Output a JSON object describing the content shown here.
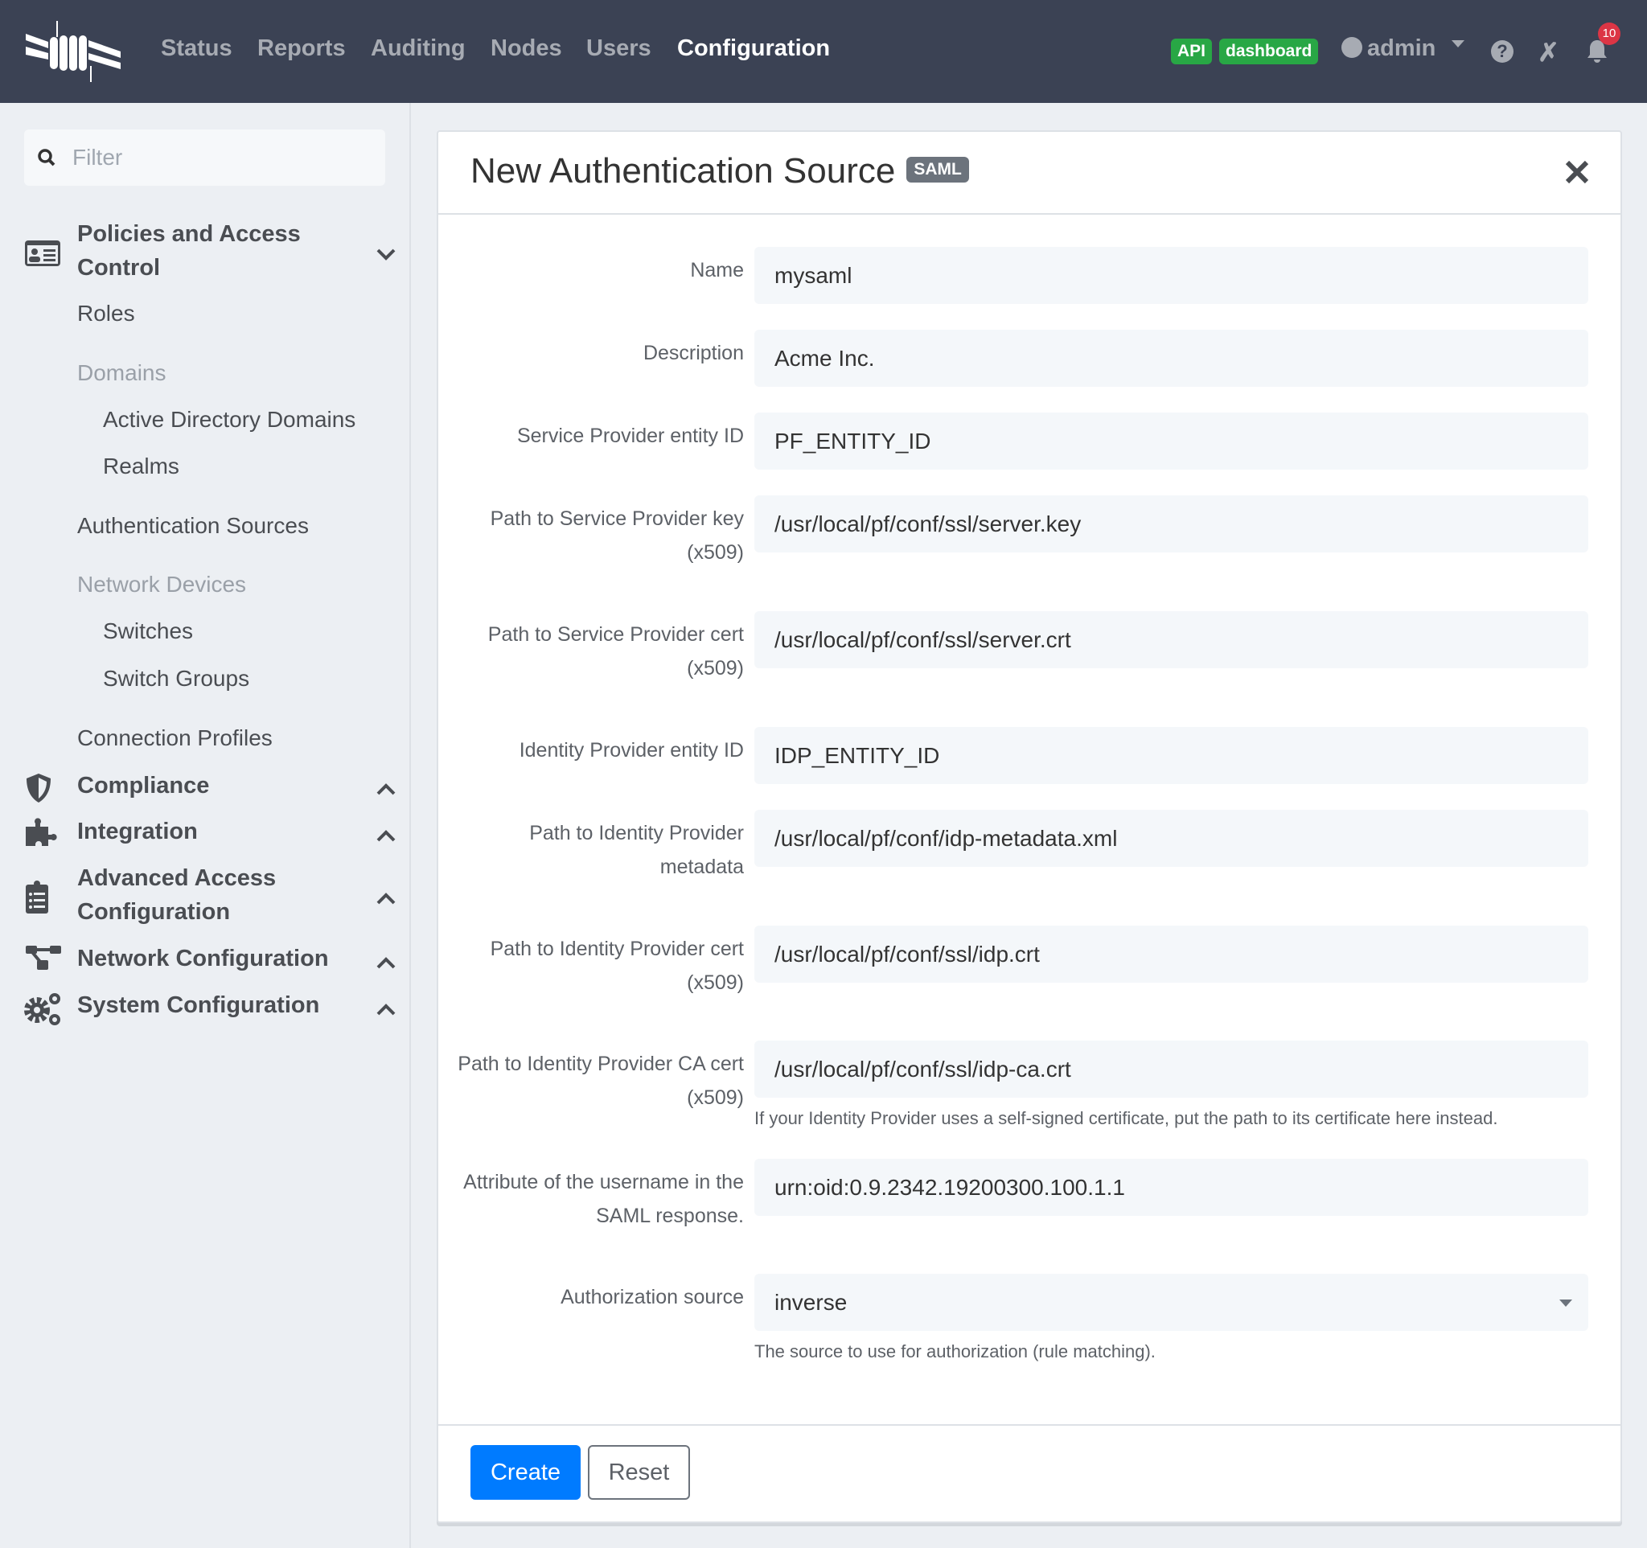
{
  "topbar": {
    "nav": [
      "Status",
      "Reports",
      "Auditing",
      "Nodes",
      "Users",
      "Configuration"
    ],
    "active": "Configuration",
    "api_badge": "API",
    "dashboard_badge": "dashboard",
    "user": "admin",
    "notifications": "10"
  },
  "sidebar": {
    "filter_placeholder": "Filter",
    "sections": {
      "policies": "Policies and Access Control",
      "compliance": "Compliance",
      "integration": "Integration",
      "advanced": "Advanced Access Configuration",
      "network": "Network Configuration",
      "system": "System Configuration"
    },
    "items": {
      "roles": "Roles",
      "domains": "Domains",
      "ad_domains": "Active Directory Domains",
      "realms": "Realms",
      "auth_sources": "Authentication Sources",
      "network_devices": "Network Devices",
      "switches": "Switches",
      "switch_groups": "Switch Groups",
      "connection_profiles": "Connection Profiles"
    }
  },
  "form": {
    "title": "New Authentication Source",
    "type_badge": "SAML",
    "fields": [
      {
        "label": "Name",
        "value": "mysaml"
      },
      {
        "label": "Description",
        "value": "Acme Inc."
      },
      {
        "label": "Service Provider entity ID",
        "value": "PF_ENTITY_ID"
      },
      {
        "label": "Path to Service Provider key (x509)",
        "value": "/usr/local/pf/conf/ssl/server.key"
      },
      {
        "label": "Path to Service Provider cert (x509)",
        "value": "/usr/local/pf/conf/ssl/server.crt"
      },
      {
        "label": "Identity Provider entity ID",
        "value": "IDP_ENTITY_ID"
      },
      {
        "label": "Path to Identity Provider metadata",
        "value": "/usr/local/pf/conf/idp-metadata.xml"
      },
      {
        "label": "Path to Identity Provider cert (x509)",
        "value": "/usr/local/pf/conf/ssl/idp.crt"
      },
      {
        "label": "Path to Identity Provider CA cert (x509)",
        "value": "/usr/local/pf/conf/ssl/idp-ca.crt",
        "help": "If your Identity Provider uses a self-signed certificate, put the path to its certificate here instead."
      },
      {
        "label": "Attribute of the username in the SAML response.",
        "value": "urn:oid:0.9.2342.19200300.100.1.1"
      },
      {
        "label": "Authorization source",
        "value": "inverse",
        "help": "The source to use for authorization (rule matching)."
      }
    ],
    "create": "Create",
    "reset": "Reset"
  },
  "colors": {
    "topbar": "#3b4254",
    "primary": "#007bff",
    "success": "#28a745",
    "danger": "#dc3545"
  }
}
